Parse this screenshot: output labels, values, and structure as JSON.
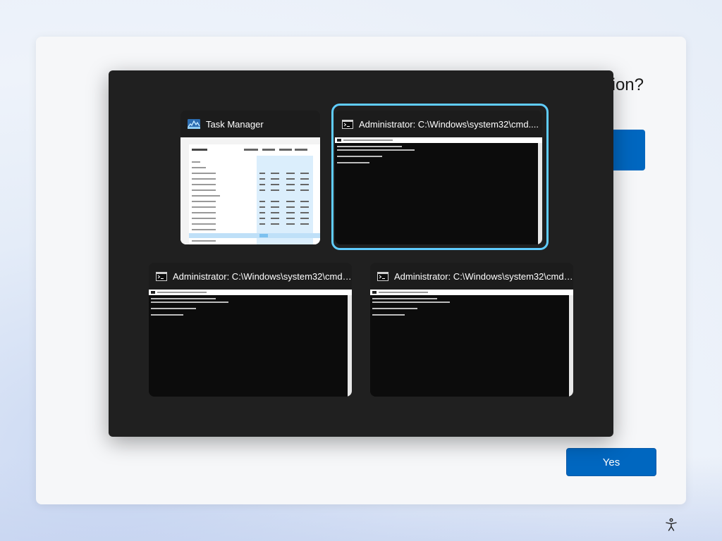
{
  "oobe": {
    "question_fragment": "ion?",
    "yes_label": "Yes"
  },
  "switcher": {
    "windows": [
      {
        "title": "Task Manager",
        "icon": "task-manager-icon",
        "selected": false
      },
      {
        "title": "Administrator: C:\\Windows\\system32\\cmd....",
        "icon": "cmd-icon",
        "selected": true
      },
      {
        "title": "Administrator: C:\\Windows\\system32\\cmd....",
        "icon": "cmd-icon",
        "selected": false
      },
      {
        "title": "Administrator: C:\\Windows\\system32\\cmd....",
        "icon": "cmd-icon",
        "selected": false
      }
    ]
  },
  "colors": {
    "accent": "#0067c0",
    "selection_ring": "#60cdff",
    "switcher_bg": "#202020"
  },
  "taskbar": {
    "accessibility_icon": "accessibility-icon"
  }
}
